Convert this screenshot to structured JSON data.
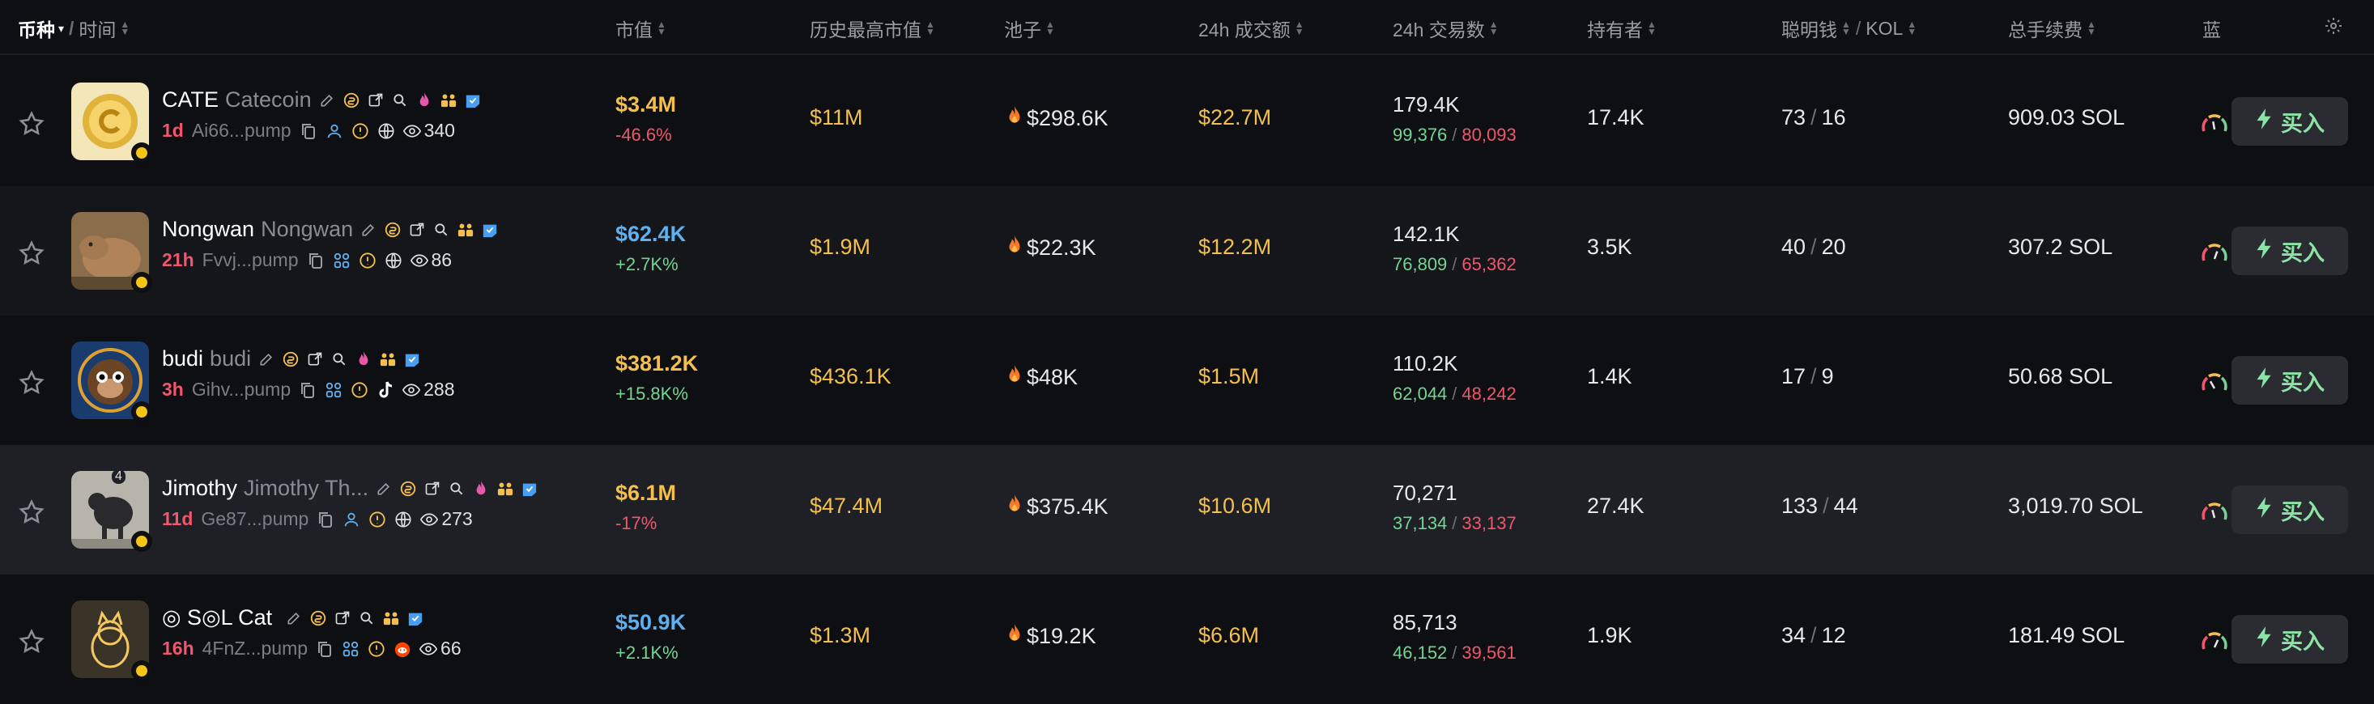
{
  "header": {
    "coin": "币种",
    "sep": "/",
    "time": "时间",
    "mcap": "市值",
    "ath": "历史最高市值",
    "pool": "池子",
    "volume": "24h 成交额",
    "txs": "24h 交易数",
    "holders": "持有者",
    "smart": "聪明钱",
    "kol": "KOL",
    "fees": "总手续费",
    "blue": "蓝"
  },
  "buy_label": "买入",
  "rows": [
    {
      "symbol": "CATE",
      "name": "Catecoin",
      "age": "1d",
      "addr": "Ai66...pump",
      "views": "340",
      "mcap": "$3.4M",
      "mcap_color": "gold",
      "mcap_change": "-46.6%",
      "change_color": "red",
      "ath": "$11M",
      "pool": "$298.6K",
      "volume": "$22.7M",
      "txs": "179.4K",
      "buys": "99,376",
      "sells": "80,093",
      "holders": "17.4K",
      "smart": "73",
      "kol": "16",
      "fees": "909.03 SOL"
    },
    {
      "symbol": "Nongwan",
      "name": "Nongwan",
      "age": "21h",
      "addr": "Fvvj...pump",
      "views": "86",
      "mcap": "$62.4K",
      "mcap_color": "blue",
      "mcap_change": "+2.7K%",
      "change_color": "green",
      "ath": "$1.9M",
      "pool": "$22.3K",
      "volume": "$12.2M",
      "txs": "142.1K",
      "buys": "76,809",
      "sells": "65,362",
      "holders": "3.5K",
      "smart": "40",
      "kol": "20",
      "fees": "307.2 SOL"
    },
    {
      "symbol": "budi",
      "name": "budi",
      "age": "3h",
      "addr": "Gihv...pump",
      "views": "288",
      "mcap": "$381.2K",
      "mcap_color": "gold",
      "mcap_change": "+15.8K%",
      "change_color": "green",
      "ath": "$436.1K",
      "pool": "$48K",
      "volume": "$1.5M",
      "txs": "110.2K",
      "buys": "62,044",
      "sells": "48,242",
      "holders": "1.4K",
      "smart": "17",
      "kol": "9",
      "fees": "50.68 SOL"
    },
    {
      "symbol": "Jimothy",
      "name": "Jimothy Th...",
      "age": "11d",
      "addr": "Ge87...pump",
      "views": "273",
      "count_badge": "4",
      "mcap": "$6.1M",
      "mcap_color": "gold",
      "mcap_change": "-17%",
      "change_color": "red",
      "ath": "$47.4M",
      "pool": "$375.4K",
      "volume": "$10.6M",
      "txs": "70,271",
      "buys": "37,134",
      "sells": "33,137",
      "holders": "27.4K",
      "smart": "133",
      "kol": "44",
      "fees": "3,019.70 SOL"
    },
    {
      "symbol": "◎ S◎L Cat",
      "name": "",
      "age": "16h",
      "addr": "4FnZ...pump",
      "views": "66",
      "mcap": "$50.9K",
      "mcap_color": "blue",
      "mcap_change": "+2.1K%",
      "change_color": "green",
      "ath": "$1.3M",
      "pool": "$19.2K",
      "volume": "$6.6M",
      "txs": "85,713",
      "buys": "46,152",
      "sells": "39,561",
      "holders": "1.9K",
      "smart": "34",
      "kol": "12",
      "fees": "181.49 SOL"
    }
  ]
}
